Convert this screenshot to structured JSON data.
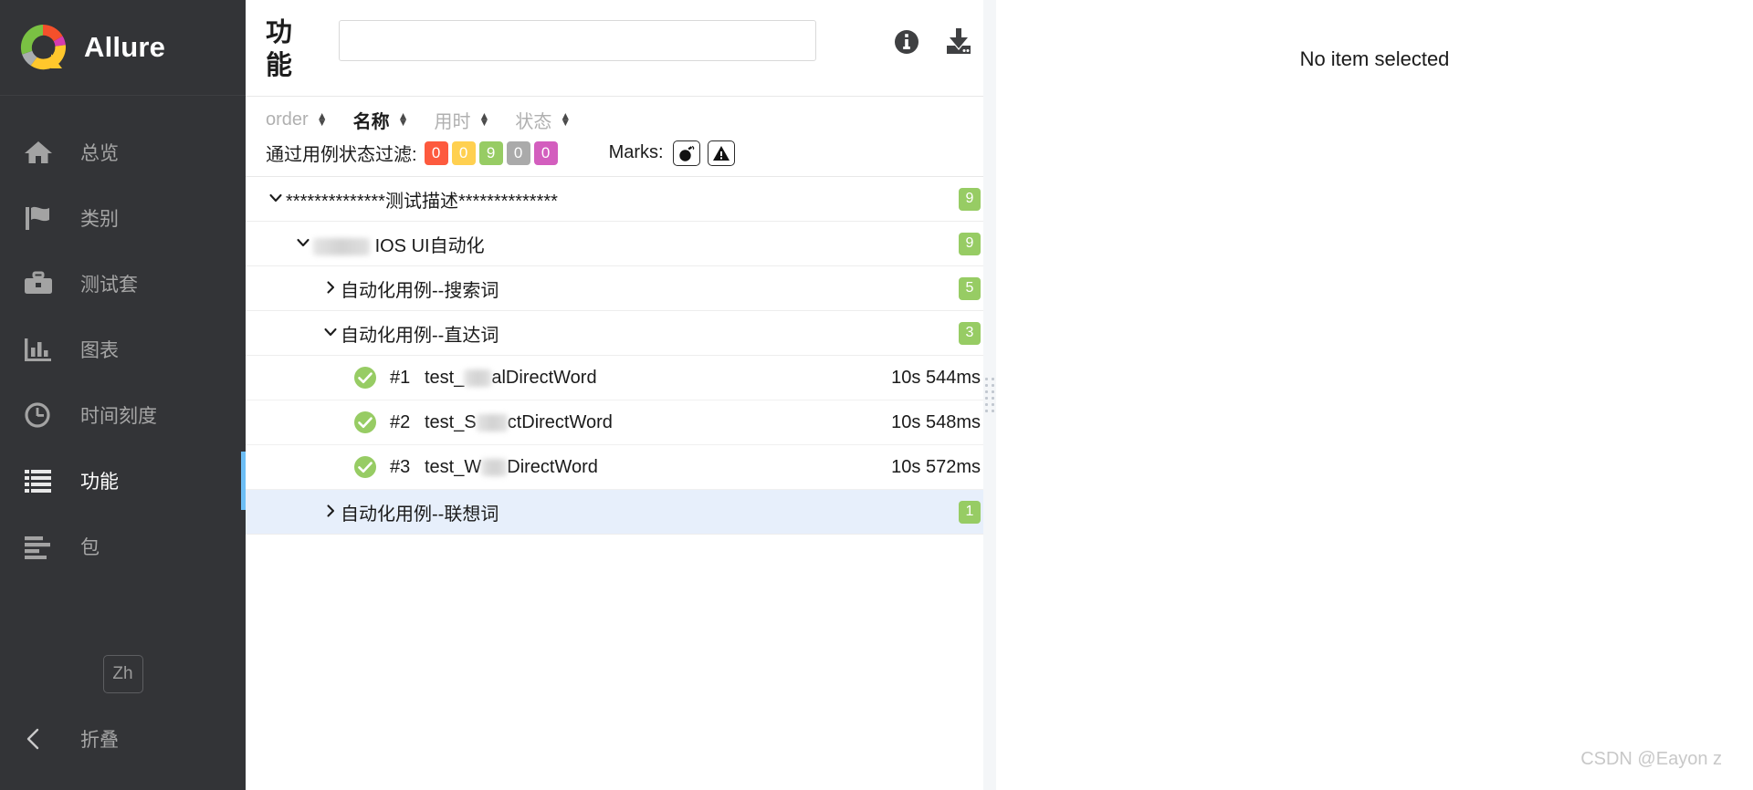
{
  "sidebar": {
    "brand": {
      "name": "Allure",
      "logo_icon": "allure-logo-icon"
    },
    "items": [
      {
        "label": "总览",
        "icon": "home-icon",
        "active": false
      },
      {
        "label": "类别",
        "icon": "flag-icon",
        "active": false
      },
      {
        "label": "测试套",
        "icon": "briefcase-icon",
        "active": false
      },
      {
        "label": "图表",
        "icon": "bar-chart-icon",
        "active": false
      },
      {
        "label": "时间刻度",
        "icon": "clock-icon",
        "active": false
      },
      {
        "label": "功能",
        "icon": "list-icon",
        "active": true
      },
      {
        "label": "包",
        "icon": "package-lines-icon",
        "active": false
      }
    ],
    "language_button": "Zh",
    "collapse_label": "折叠",
    "collapse_icon": "chevron-left-icon",
    "accent_color": "#6dbef5"
  },
  "tree_panel": {
    "title": "功能",
    "search": {
      "value": "",
      "placeholder": ""
    },
    "actions": [
      {
        "name": "info-icon",
        "label": "信息"
      },
      {
        "name": "download-icon",
        "label": "下载"
      }
    ],
    "sort": {
      "items": [
        {
          "label": "order",
          "active": false
        },
        {
          "label": "名称",
          "active": true
        },
        {
          "label": "用时",
          "active": false
        },
        {
          "label": "状态",
          "active": false
        }
      ],
      "arrow_up": "▲",
      "arrow_down": "▼"
    },
    "filter": {
      "label": "通过用例状态过滤:",
      "chips": [
        {
          "value": "0",
          "color": "#fd5a3e",
          "status": "failed"
        },
        {
          "value": "0",
          "color": "#ffd050",
          "status": "broken"
        },
        {
          "value": "9",
          "color": "#97cc64",
          "status": "passed"
        },
        {
          "value": "0",
          "color": "#aaaaaa",
          "status": "skipped"
        },
        {
          "value": "0",
          "color": "#d35ebe",
          "status": "unknown"
        }
      ],
      "marks_label": "Marks:",
      "marks": [
        {
          "name": "bomb-icon",
          "title": "flaky"
        },
        {
          "name": "warning-triangle-icon",
          "title": "known issue"
        }
      ]
    },
    "rows": [
      {
        "type": "group",
        "depth": 0,
        "expanded": true,
        "twisty": "chevron-down-icon",
        "title_prefix": "**************",
        "title": "测试描述",
        "title_suffix": "**************",
        "count": "9",
        "selected": false
      },
      {
        "type": "group",
        "depth": 1,
        "expanded": true,
        "twisty": "chevron-down-icon",
        "title_prefix": "",
        "redacted": true,
        "title": "IOS UI自动化",
        "title_suffix": "",
        "count": "9",
        "selected": false
      },
      {
        "type": "group",
        "depth": 2,
        "expanded": false,
        "twisty": "chevron-right-icon",
        "title": "自动化用例--搜索词",
        "count": "5",
        "selected": false
      },
      {
        "type": "group",
        "depth": 2,
        "expanded": true,
        "twisty": "chevron-down-icon",
        "title": "自动化用例--直达词",
        "count": "3",
        "selected": false
      },
      {
        "type": "leaf",
        "depth": 3,
        "status": "passed",
        "status_icon": "check-circle-icon",
        "number": "#1",
        "name_before": "test_",
        "name_after": "alDirectWord",
        "duration": "10s 544ms",
        "selected": false
      },
      {
        "type": "leaf",
        "depth": 3,
        "status": "passed",
        "status_icon": "check-circle-icon",
        "number": "#2",
        "name_before": "test_S",
        "name_after": "ctDirectWord",
        "duration": "10s 548ms",
        "selected": false
      },
      {
        "type": "leaf",
        "depth": 3,
        "status": "passed",
        "status_icon": "check-circle-icon",
        "number": "#3",
        "name_before": "test_W",
        "name_after": "DirectWord",
        "duration": "10s 572ms",
        "selected": false
      },
      {
        "type": "group",
        "depth": 2,
        "expanded": false,
        "twisty": "chevron-right-icon",
        "title": "自动化用例--联想词",
        "count": "1",
        "selected": true
      }
    ]
  },
  "detail_panel": {
    "empty_message": "No item selected"
  },
  "watermark": "CSDN @Eayon z"
}
